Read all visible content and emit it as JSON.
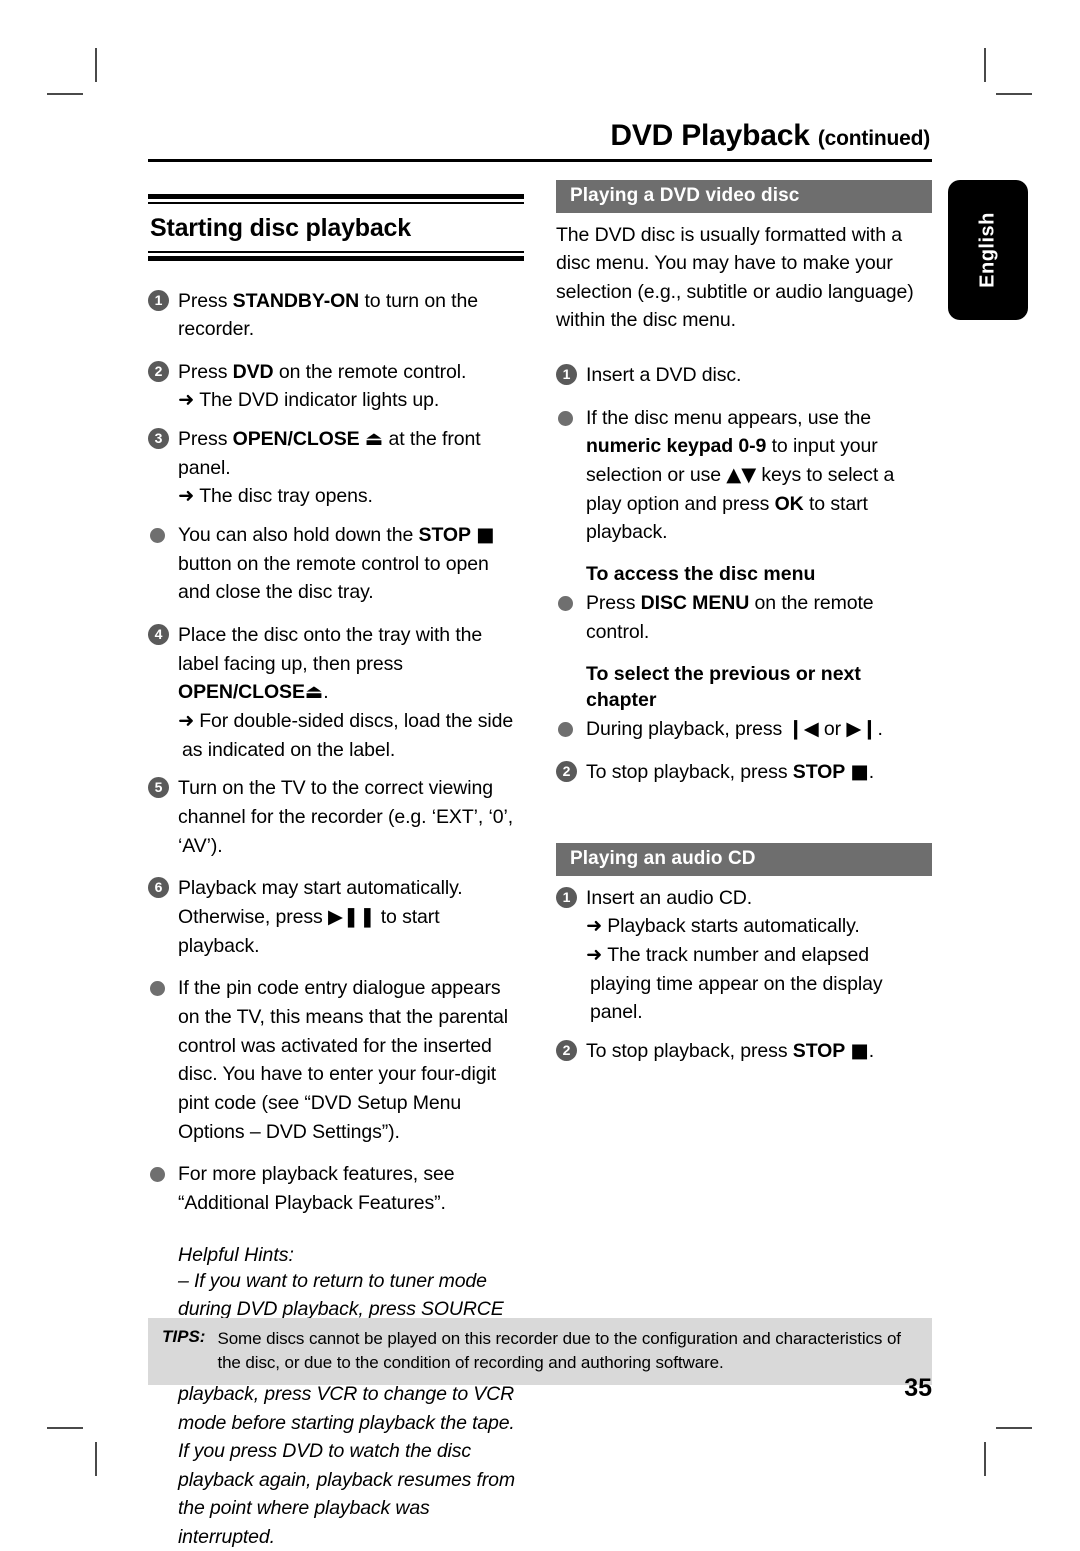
{
  "header": {
    "title": "DVD Playback",
    "continued": "(continued)"
  },
  "language_tab": "English",
  "left_column": {
    "section_heading": "Starting disc playback",
    "steps": [
      {
        "marker": "1",
        "text_html": "Press <b>STANDBY-ON</b> to turn on the recorder.",
        "text": "Press STANDBY-ON to turn on the recorder."
      },
      {
        "marker": "2",
        "text_html": "Press <b>DVD</b> on the remote control.",
        "text": "Press DVD on the remote control.",
        "sub": [
          "The DVD indicator lights up."
        ]
      },
      {
        "marker": "3",
        "text_html": "Press <b>OPEN/CLOSE</b> <span class=\"glyph\">⏏</span> at the front panel.",
        "text": "Press OPEN/CLOSE ⏏ at the front panel.",
        "sub": [
          "The disc tray opens."
        ]
      },
      {
        "marker": "bullet",
        "text_html": "You can also hold down the <b>STOP</b> <span class=\"glyph\">■</span> button on the remote control to open and close the disc tray.",
        "text": "You can also hold down the STOP ■ button on the remote control to open and close the disc tray."
      },
      {
        "marker": "4",
        "text_html": "Place the disc onto the tray with the label facing up, then press <b>OPEN/CLOSE</b><span class=\"glyph\">⏏</span>.",
        "text": "Place the disc onto the tray with the label facing up, then press OPEN/CLOSE ⏏.",
        "sub": [
          "For double-sided discs, load the side as indicated on the label."
        ]
      },
      {
        "marker": "5",
        "text_html": "Turn on the TV to the correct viewing channel for the recorder (e.g. ‘EXT’, ‘0’, ‘AV’).",
        "text": "Turn on the TV to the correct viewing channel for the recorder (e.g. ‘EXT’, ‘0’, ‘AV’)."
      },
      {
        "marker": "6",
        "text_html": "Playback may start automatically. Otherwise, press <span class=\"glyph\">▶❚❚</span> to start playback.",
        "text": "Playback may start automatically. Otherwise, press ▶❚❚ to start playback."
      },
      {
        "marker": "bullet",
        "text_html": "If the pin code entry dialogue appears on the TV, this means that the parental control was activated for the inserted disc.  You have to enter your four-digit pint code (see “DVD Setup Menu Options – DVD Settings”).",
        "text": "If the pin code entry dialogue appears on the TV, this means that the parental control was activated for the inserted disc.  You have to enter your four-digit pint code (see “DVD Setup Menu Options – DVD Settings”)."
      },
      {
        "marker": "bullet",
        "text_html": "For more playback features, see “Additional Playback Features”.",
        "text": "For more playback features, see “Additional Playback Features”."
      }
    ],
    "hints_title": "Helpful Hints:",
    "hints": [
      "– If you want to return to tuner mode during DVD playback, press SOURCE button.",
      "– If you wish to watch the VCR playback, press VCR to change to VCR mode before starting playback the tape. If you press DVD to watch the disc playback again, playback resumes from the point where playback was interrupted."
    ]
  },
  "right_column": {
    "dvd_section": {
      "band_title": "Playing a DVD video disc",
      "intro": "The DVD disc is usually formatted with a disc menu. You may have to make your selection (e.g., subtitle or audio language) within the disc menu.",
      "steps": [
        {
          "marker": "1",
          "text_html": "Insert a DVD disc.",
          "text": "Insert a DVD disc."
        },
        {
          "marker": "bullet",
          "text_html": "If the disc menu appears, use the <b>numeric keypad 0-9</b> to input your selection or use <span class=\"glyph\">▲▼</span> keys to select a play option and press <b>OK</b> to start playback.",
          "text": "If the disc menu appears, use the numeric keypad 0-9 to input your selection or use ▲▼ keys to select a play option and press OK to start playback."
        }
      ],
      "subhead_menu": "To access the disc menu",
      "menu_step": {
        "marker": "bullet",
        "text_html": "Press <b>DISC MENU</b> on the remote control.",
        "text": "Press DISC MENU on the remote control."
      },
      "subhead_chapter": "To select the previous or next chapter",
      "chapter_steps": [
        {
          "marker": "bullet",
          "text_html": "During playback, press <span class=\"glyph\">❙◀</span> or <span class=\"glyph\">▶❙</span>.",
          "text": "During playback, press ❙◀ or ▶❙."
        },
        {
          "marker": "2",
          "text_html": "To stop playback, press <b>STOP</b> <span class=\"glyph\">■</span>.",
          "text": "To stop playback, press STOP ■."
        }
      ]
    },
    "cd_section": {
      "band_title": "Playing an audio CD",
      "steps": [
        {
          "marker": "1",
          "text_html": "Insert an audio CD.",
          "text": "Insert an audio CD.",
          "sub": [
            "Playback starts automatically.",
            "The track number and elapsed playing time appear on the display panel."
          ]
        },
        {
          "marker": "2",
          "text_html": "To stop playback, press <b>STOP</b> <span class=\"glyph\">■</span>.",
          "text": "To stop playback, press STOP ■."
        }
      ]
    }
  },
  "footer": {
    "tips_label": "TIPS:",
    "tips_text": "Some discs cannot be played on this recorder due to the configuration and characteristics of the disc, or due to the condition of recording and authoring software.",
    "page_number": "35"
  },
  "colors": {
    "band_gray": "#6e6e6e",
    "marker_gray": "#5a5a5a",
    "tips_gray": "#d9d9d9",
    "tab_black": "#000000"
  }
}
